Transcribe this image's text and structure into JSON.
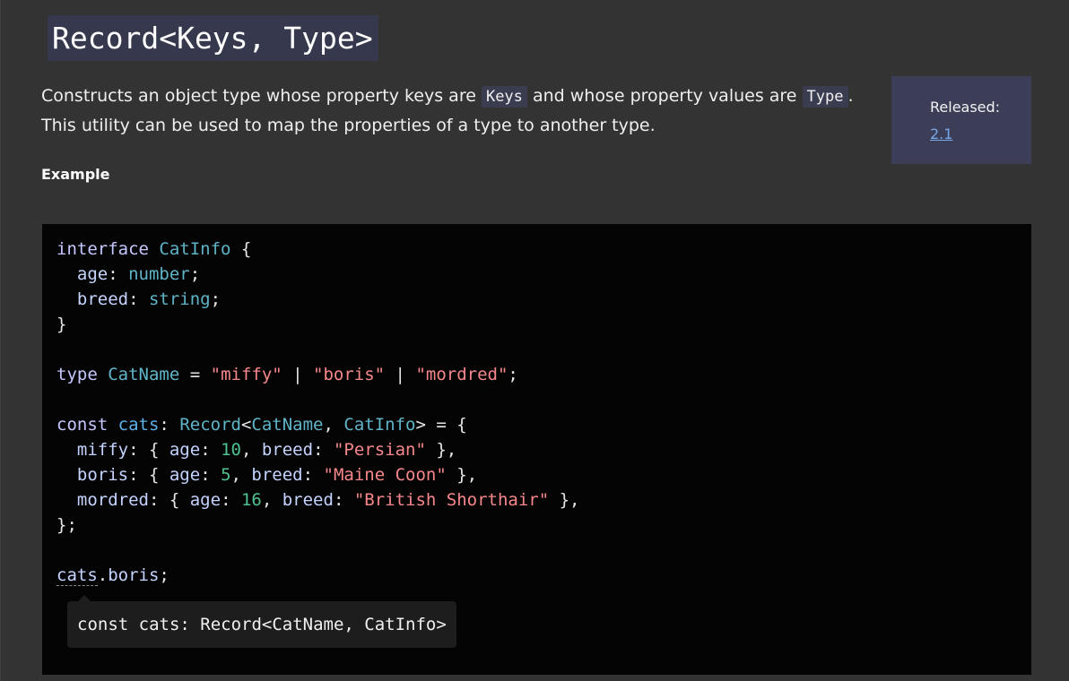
{
  "page": {
    "title": "Record<Keys, Type>",
    "description": {
      "line1_before": "Constructs an object type whose property keys are ",
      "code_keys": "Keys",
      "line1_middle": " and whose property values are ",
      "code_type": "Type",
      "line1_after": ".",
      "line2": "This utility can be used to map the properties of a type to another type."
    },
    "release": {
      "label": "Released:",
      "version": "2.1"
    },
    "example_heading": "Example"
  },
  "code": {
    "lines": [
      [
        [
          "kw",
          "interface"
        ],
        [
          "pu",
          " "
        ],
        [
          "ty",
          "CatInfo"
        ],
        [
          "pu",
          " {"
        ]
      ],
      [
        [
          "pu",
          "  "
        ],
        [
          "id",
          "age"
        ],
        [
          "pu",
          ": "
        ],
        [
          "ty",
          "number"
        ],
        [
          "pu",
          ";"
        ]
      ],
      [
        [
          "pu",
          "  "
        ],
        [
          "id",
          "breed"
        ],
        [
          "pu",
          ": "
        ],
        [
          "ty",
          "string"
        ],
        [
          "pu",
          ";"
        ]
      ],
      [
        [
          "pu",
          "}"
        ]
      ],
      [],
      [
        [
          "kw",
          "type"
        ],
        [
          "pu",
          " "
        ],
        [
          "ty",
          "CatName"
        ],
        [
          "pu",
          " = "
        ],
        [
          "str",
          "\"miffy\""
        ],
        [
          "pu",
          " | "
        ],
        [
          "str",
          "\"boris\""
        ],
        [
          "pu",
          " | "
        ],
        [
          "str",
          "\"mordred\""
        ],
        [
          "pu",
          ";"
        ]
      ],
      [],
      [
        [
          "kw",
          "const"
        ],
        [
          "pu",
          " "
        ],
        [
          "var",
          "cats"
        ],
        [
          "pu",
          ": "
        ],
        [
          "ty",
          "Record"
        ],
        [
          "pu",
          "<"
        ],
        [
          "ty",
          "CatName"
        ],
        [
          "pu",
          ", "
        ],
        [
          "ty",
          "CatInfo"
        ],
        [
          "pu",
          "> = {"
        ]
      ],
      [
        [
          "pu",
          "  "
        ],
        [
          "id",
          "miffy"
        ],
        [
          "pu",
          ": { "
        ],
        [
          "id",
          "age"
        ],
        [
          "pu",
          ": "
        ],
        [
          "num",
          "10"
        ],
        [
          "pu",
          ", "
        ],
        [
          "id",
          "breed"
        ],
        [
          "pu",
          ": "
        ],
        [
          "str",
          "\"Persian\""
        ],
        [
          "pu",
          " },"
        ]
      ],
      [
        [
          "pu",
          "  "
        ],
        [
          "id",
          "boris"
        ],
        [
          "pu",
          ": { "
        ],
        [
          "id",
          "age"
        ],
        [
          "pu",
          ": "
        ],
        [
          "num",
          "5"
        ],
        [
          "pu",
          ", "
        ],
        [
          "id",
          "breed"
        ],
        [
          "pu",
          ": "
        ],
        [
          "str",
          "\"Maine Coon\""
        ],
        [
          "pu",
          " },"
        ]
      ],
      [
        [
          "pu",
          "  "
        ],
        [
          "id",
          "mordred"
        ],
        [
          "pu",
          ": { "
        ],
        [
          "id",
          "age"
        ],
        [
          "pu",
          ": "
        ],
        [
          "num",
          "16"
        ],
        [
          "pu",
          ", "
        ],
        [
          "id",
          "breed"
        ],
        [
          "pu",
          ": "
        ],
        [
          "str",
          "\"British Shorthair\""
        ],
        [
          "pu",
          " },"
        ]
      ],
      [
        [
          "pu",
          "};"
        ]
      ],
      [],
      [
        [
          "hover",
          "cats"
        ],
        [
          "pu",
          "."
        ],
        [
          "id",
          "boris"
        ],
        [
          "pu",
          ";"
        ]
      ]
    ],
    "tooltip": "const cats: Record<CatName, CatInfo>"
  }
}
